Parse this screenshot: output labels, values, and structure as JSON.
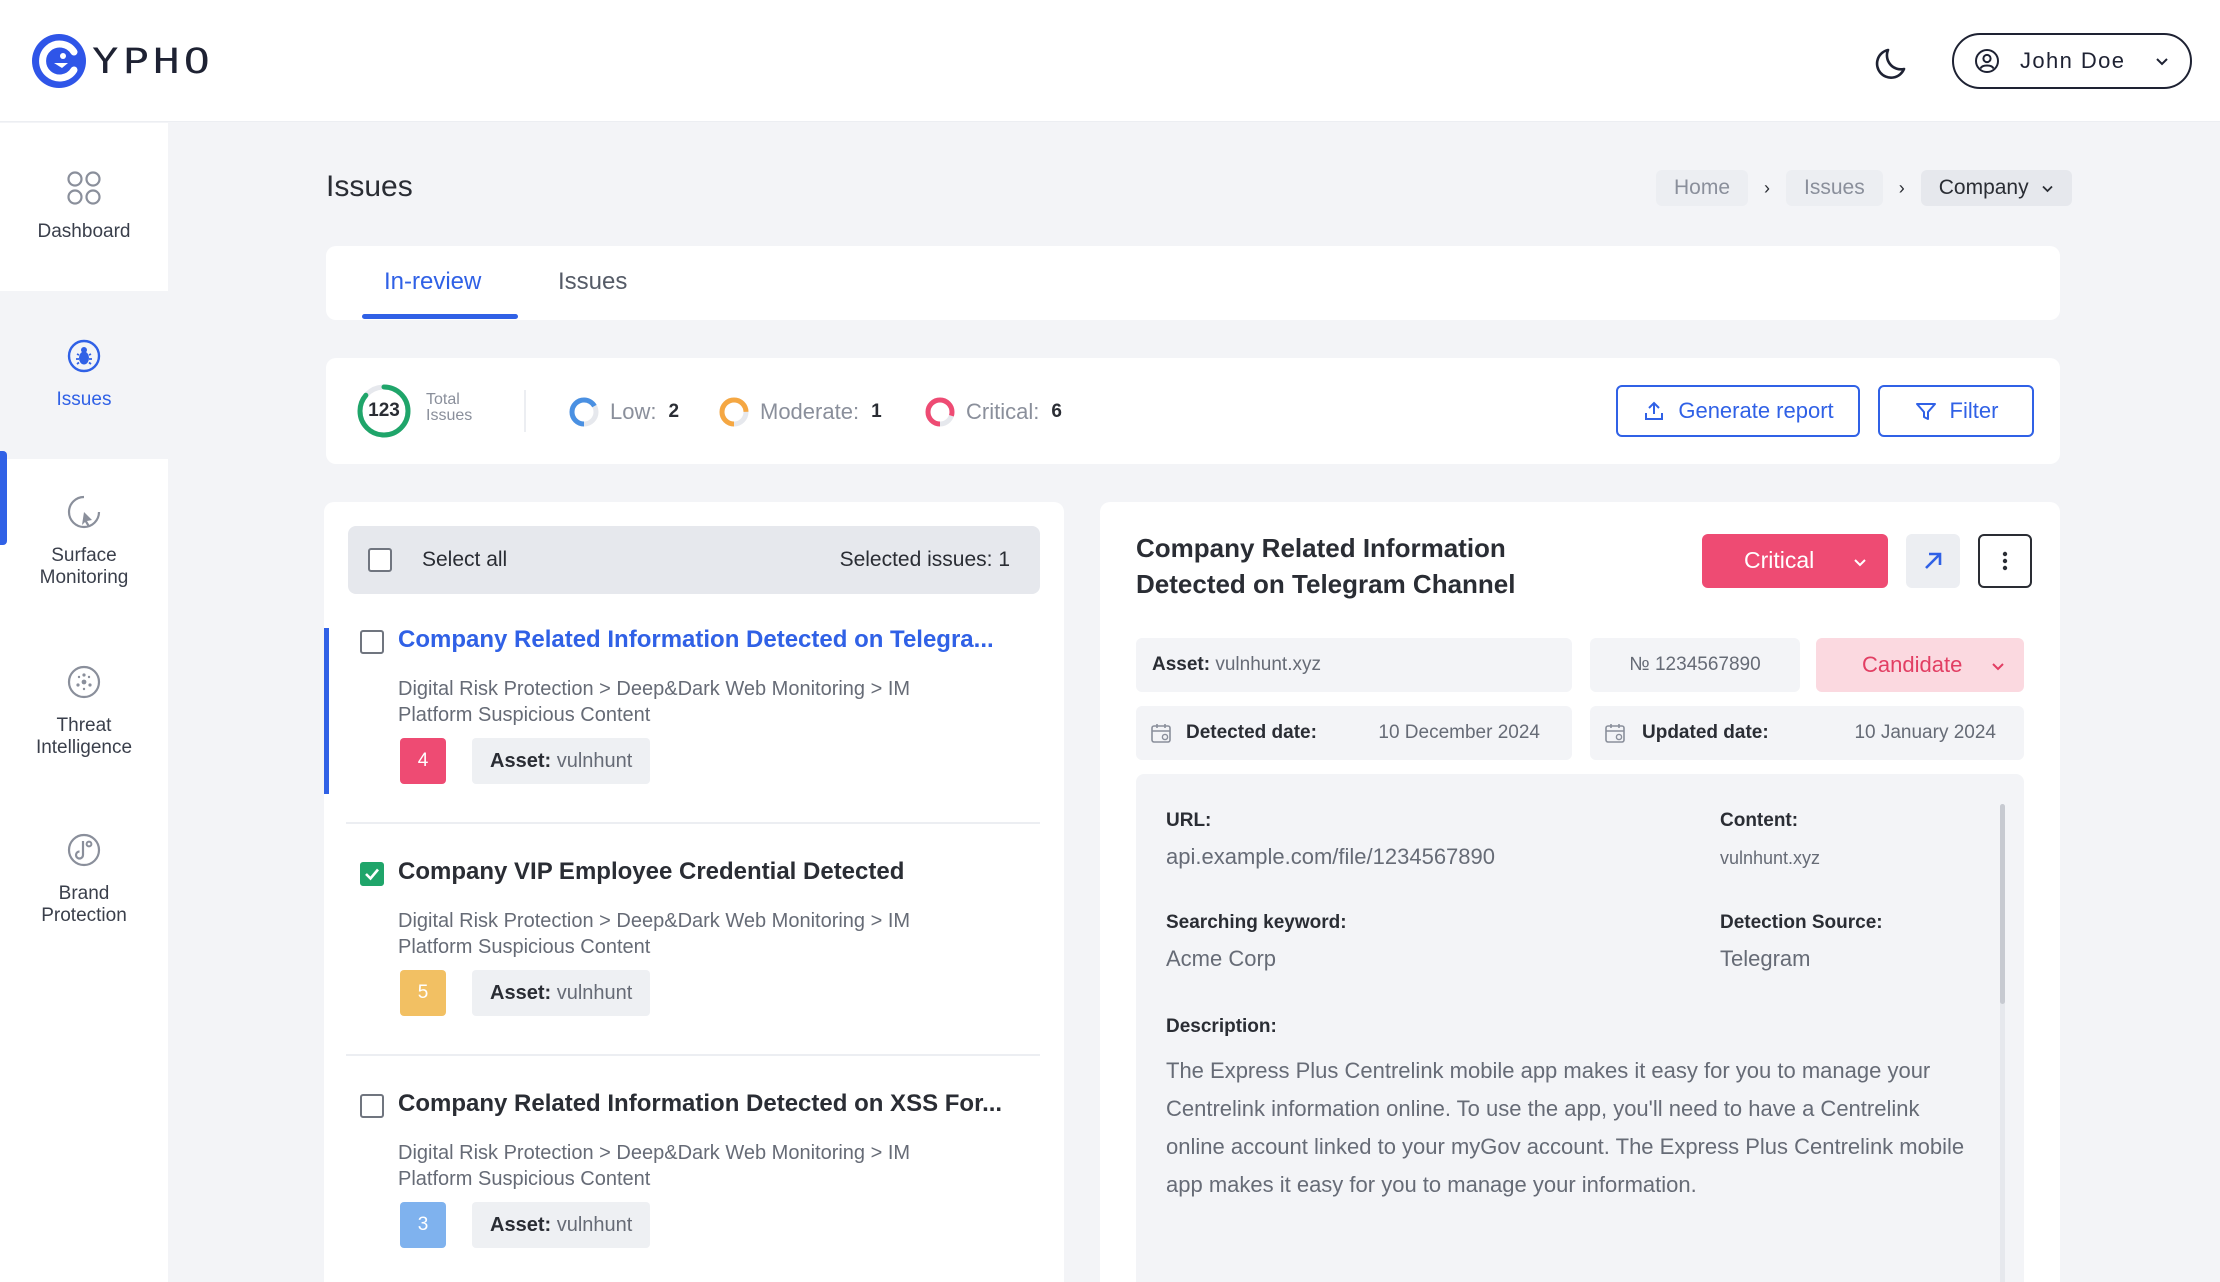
{
  "brand": {
    "name": "YPHO"
  },
  "header": {
    "user_name": "John Doe",
    "theme_icon": "moon-icon"
  },
  "sidebar": {
    "items": [
      {
        "label": "Dashboard",
        "icon": "grid-icon"
      },
      {
        "label": "Issues",
        "icon": "bug-icon"
      },
      {
        "label": "Surface Monitoring",
        "icon": "radar-icon"
      },
      {
        "label": "Threat Intelligence",
        "icon": "threat-icon"
      },
      {
        "label": "Brand Protection",
        "icon": "brand-icon"
      }
    ],
    "active": "Issues"
  },
  "page": {
    "title": "Issues",
    "breadcrumbs": [
      "Home",
      "Issues",
      "Company"
    ]
  },
  "tabs": [
    {
      "label": "In-review",
      "active": true
    },
    {
      "label": "Issues",
      "active": false
    }
  ],
  "stats": {
    "total": "123",
    "total_label_1": "Total",
    "total_label_2": "Issues",
    "low_label": "Low:",
    "low": "2",
    "moderate_label": "Moderate:",
    "moderate": "1",
    "critical_label": "Critical:",
    "critical": "6",
    "generate_label": "Generate report",
    "filter_label": "Filter",
    "colors": {
      "low": "#4a90e2",
      "moderate": "#f5a742",
      "critical": "#ee4b73",
      "total": "#1fa56a"
    }
  },
  "list": {
    "select_all": "Select all",
    "selected_label": "Selected issues: 1",
    "issues": [
      {
        "title": "Company Related Information Detected on Telegra...",
        "path_1": "Digital Risk Protection > Deep&Dark Web Monitoring > IM",
        "path_2": "Platform Suspicious Content",
        "badge": "4",
        "badge_color": "#ee4b73",
        "asset_key": "Asset:",
        "asset_val": "vulnhunt",
        "checked": false,
        "selected": true
      },
      {
        "title": "Company VIP Employee Credential Detected",
        "path_1": "Digital Risk Protection > Deep&Dark Web Monitoring > IM",
        "path_2": "Platform Suspicious Content",
        "badge": "5",
        "badge_color": "#f2c063",
        "asset_key": "Asset:",
        "asset_val": "vulnhunt",
        "checked": true,
        "selected": false
      },
      {
        "title": "Company Related Information Detected on XSS For...",
        "path_1": "Digital Risk Protection > Deep&Dark Web Monitoring > IM",
        "path_2": "Platform Suspicious Content",
        "badge": "3",
        "badge_color": "#7fb2ee",
        "asset_key": "Asset:",
        "asset_val": "vulnhunt",
        "checked": false,
        "selected": false
      }
    ]
  },
  "detail": {
    "title_1": "Company Related Information",
    "title_2": "Detected on Telegram Channel",
    "severity": "Critical",
    "asset_key": "Asset:",
    "asset_val": "vulnhunt.xyz",
    "number": "№ 1234567890",
    "status": "Candidate",
    "detected_label": "Detected date:",
    "detected_date": "10 December 2024",
    "updated_label": "Updated date:",
    "updated_date": "10 January 2024",
    "url_label": "URL:",
    "url": "api.example.com/file/1234567890",
    "content_label": "Content:",
    "content": "vulnhunt.xyz",
    "keyword_label": "Searching keyword:",
    "keyword": "Acme Corp",
    "source_label": "Detection Source:",
    "source": "Telegram",
    "description_label": "Description:",
    "description": "The Express Plus Centrelink mobile app makes it easy for you to manage your Centrelink information online. To use the app, you'll need to have a Centrelink online account linked to your myGov account. The Express Plus Centrelink mobile app makes it easy for you to manage your information."
  }
}
